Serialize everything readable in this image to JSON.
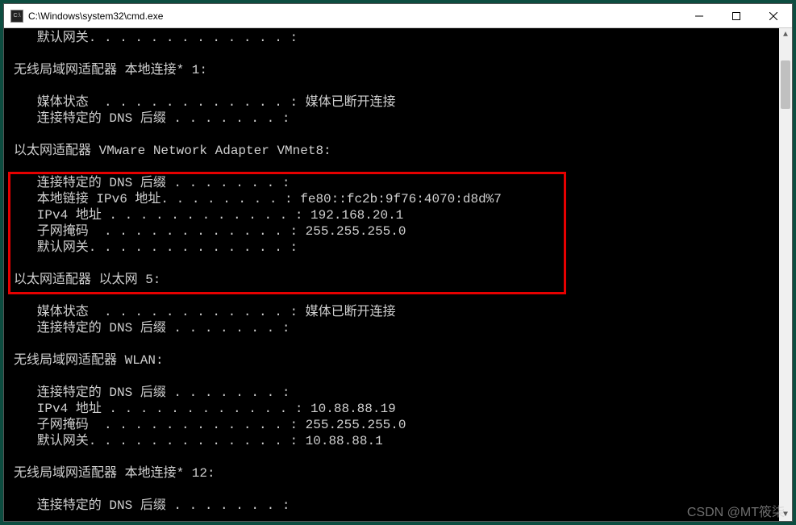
{
  "window": {
    "title": "C:\\Windows\\system32\\cmd.exe",
    "icon_label": "C:\\"
  },
  "terminal": {
    "lines": [
      "   默认网关. . . . . . . . . . . . . :",
      "",
      "无线局域网适配器 本地连接* 1:",
      "",
      "   媒体状态  . . . . . . . . . . . . : 媒体已断开连接",
      "   连接特定的 DNS 后缀 . . . . . . . :",
      "",
      "以太网适配器 VMware Network Adapter VMnet8:",
      "",
      "   连接特定的 DNS 后缀 . . . . . . . :",
      "   本地链接 IPv6 地址. . . . . . . . : fe80::fc2b:9f76:4070:d8d%7",
      "   IPv4 地址 . . . . . . . . . . . . : 192.168.20.1",
      "   子网掩码  . . . . . . . . . . . . : 255.255.255.0",
      "   默认网关. . . . . . . . . . . . . :",
      "",
      "以太网适配器 以太网 5:",
      "",
      "   媒体状态  . . . . . . . . . . . . : 媒体已断开连接",
      "   连接特定的 DNS 后缀 . . . . . . . :",
      "",
      "无线局域网适配器 WLAN:",
      "",
      "   连接特定的 DNS 后缀 . . . . . . . :",
      "   IPv4 地址 . . . . . . . . . . . . : 10.88.88.19",
      "   子网掩码  . . . . . . . . . . . . : 255.255.255.0",
      "   默认网关. . . . . . . . . . . . . : 10.88.88.1",
      "",
      "无线局域网适配器 本地连接* 12:",
      "",
      "   连接特定的 DNS 后缀 . . . . . . . :"
    ]
  },
  "watermark": "CSDN @MT筱柒"
}
